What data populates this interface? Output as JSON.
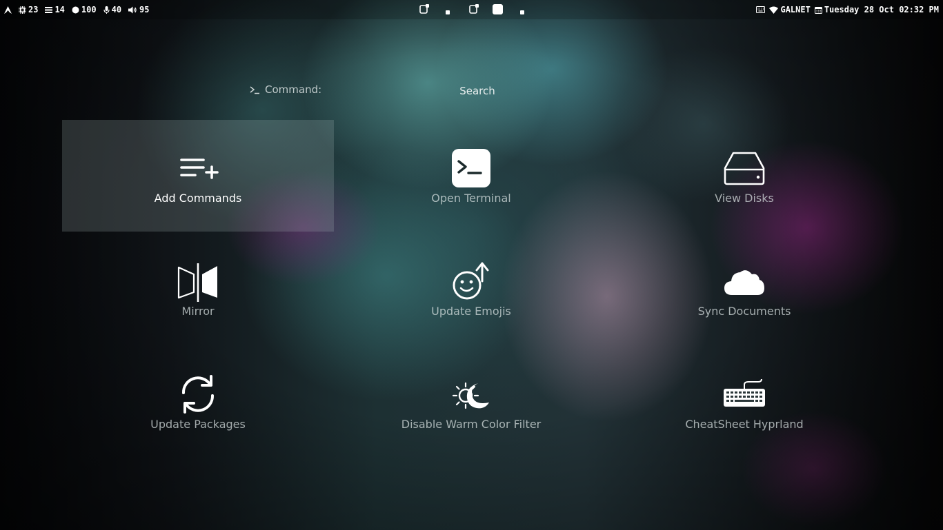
{
  "topbar": {
    "left": {
      "arch_icon": "arch-logo-icon",
      "cpu": "23",
      "tasks": "14",
      "memory": "100",
      "mic": "40",
      "volume": "95"
    },
    "workspaces": [
      "ws-1",
      "ws-2",
      "ws-3",
      "ws-4",
      "ws-5"
    ],
    "right": {
      "network": "GALNET",
      "datetime": "Tuesday 28 Oct 02:32 PM"
    }
  },
  "launcher": {
    "prompt_label": "Command:",
    "search_placeholder": "Search",
    "items": [
      {
        "label": "Add Commands",
        "icon": "add-list-icon",
        "selected": true
      },
      {
        "label": "Open Terminal",
        "icon": "terminal-icon"
      },
      {
        "label": "View Disks",
        "icon": "disk-drive-icon"
      },
      {
        "label": "Mirror",
        "icon": "mirror-icon"
      },
      {
        "label": "Update Emojis",
        "icon": "emoji-update-icon"
      },
      {
        "label": "Sync Documents",
        "icon": "cloud-icon"
      },
      {
        "label": "Update Packages",
        "icon": "refresh-icon"
      },
      {
        "label": "Disable Warm Color Filter",
        "icon": "sun-moon-icon"
      },
      {
        "label": "CheatSheet Hyprland",
        "icon": "keyboard-icon"
      }
    ]
  },
  "colors": {
    "text_primary": "#ffffff",
    "text_dim": "#dce4e4",
    "selection_bg": "#aab9b9"
  }
}
